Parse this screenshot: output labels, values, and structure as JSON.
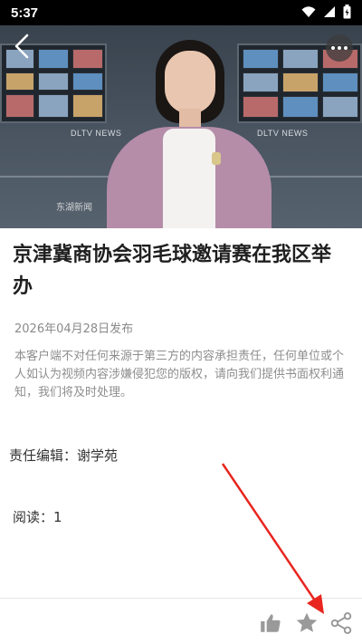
{
  "status_bar": {
    "time": "5:37",
    "icons": [
      "wifi-icon",
      "signal-icon",
      "battery-icon"
    ]
  },
  "hero": {
    "watermark_left": "DLTV NEWS",
    "watermark_right": "DLTV NEWS",
    "station_logo": "东湖新闻"
  },
  "article": {
    "title": "京津冀商协会羽毛球邀请赛在我区举办",
    "publish_date": "2026年04月28日发布",
    "disclaimer": "本客户端不对任何来源于第三方的内容承担责任，任何单位或个人如认为视频内容涉嫌侵犯您的版权，请向我们提供书面权利通知，我们将及时处理。",
    "editor": "责任编辑：谢学苑",
    "views": "阅读：1"
  },
  "toolbar": {
    "icons": [
      "thumbs-up-icon",
      "star-icon",
      "share-icon"
    ]
  },
  "colors": {
    "annotation_arrow": "#e8261f",
    "toolbar_icon": "#9a9a9a"
  }
}
